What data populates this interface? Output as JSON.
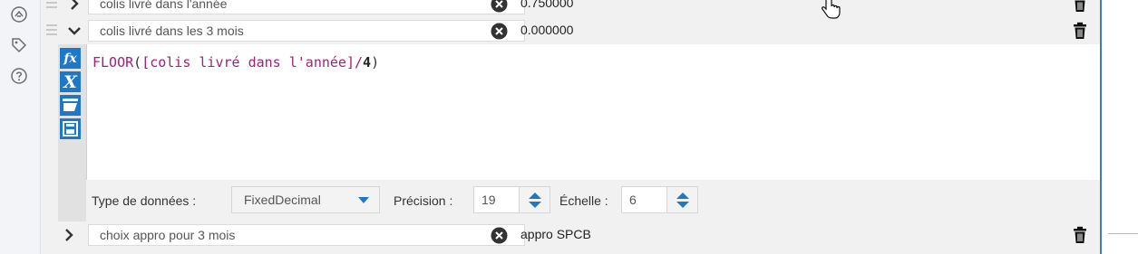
{
  "colors": {
    "accent": "#1e78c8",
    "panel_bg": "#f1f1f1",
    "field_color": "#a0207a"
  },
  "rail": {
    "icons": [
      "ai-assist-icon",
      "tag-icon",
      "help-icon"
    ]
  },
  "rows": [
    {
      "name": "colis livré dans l'année",
      "value": "0.750000",
      "expanded": false
    },
    {
      "name": "colis livré dans les 3 mois",
      "value": "0.000000",
      "expanded": true
    },
    {
      "name": "choix appro pour 3 mois",
      "value": "appro SPCB",
      "expanded": false
    }
  ],
  "expression": {
    "fn": "FLOOR",
    "open": "(",
    "field": "[colis livré dans l'année]",
    "op": "/",
    "num": "4",
    "close": ")"
  },
  "toolbar": {
    "icons": [
      "fx-function-icon",
      "variable-x-icon",
      "open-folder-icon",
      "save-disk-icon"
    ]
  },
  "type_bar": {
    "type_label": "Type de données :",
    "type_value": "FixedDecimal",
    "precision_label": "Précision :",
    "precision_value": "19",
    "scale_label": "Échelle :",
    "scale_value": "6"
  }
}
